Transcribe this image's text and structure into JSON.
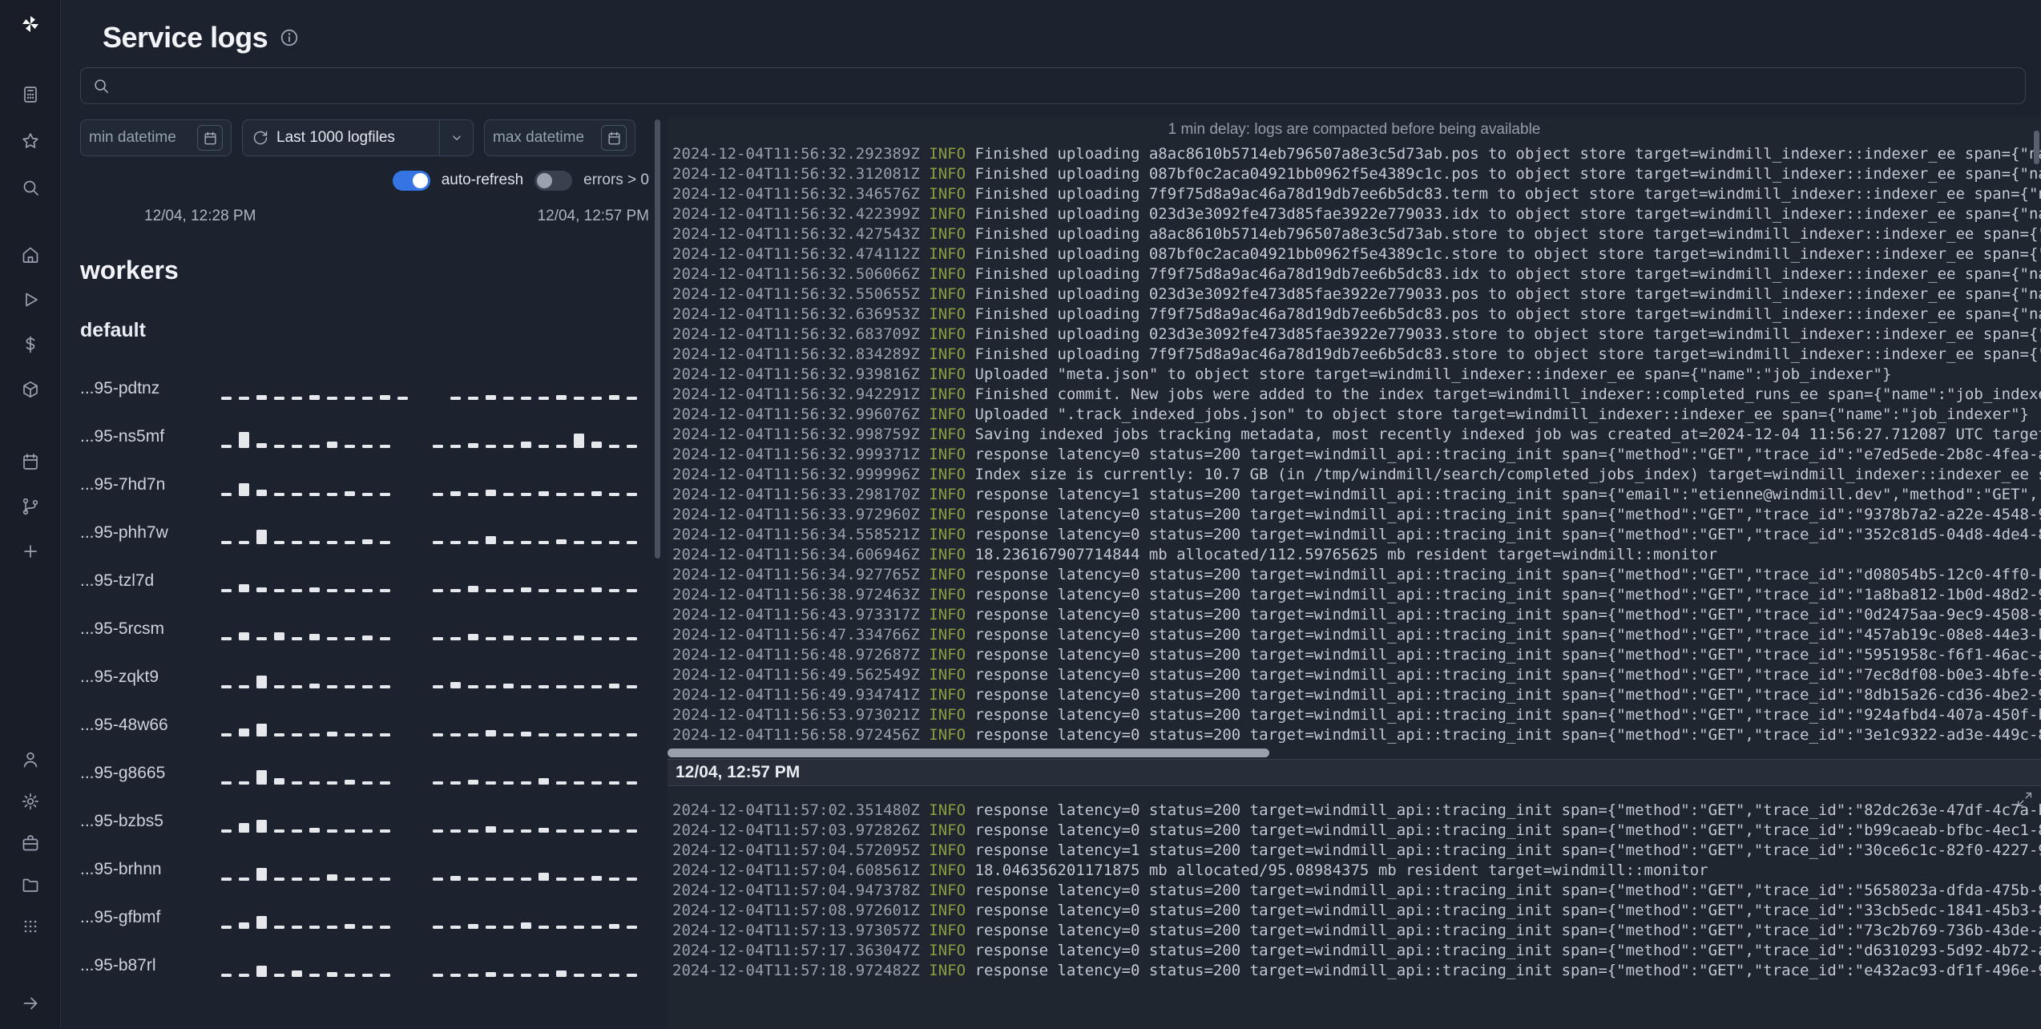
{
  "colors": {
    "accent_blue": "#3575e3",
    "log_info_green": "#8c9c41",
    "spark_bar": "#e6e8ec"
  },
  "header": {
    "title": "Service logs"
  },
  "sidebar": {
    "icons": [
      "windmill-logo",
      "calculator",
      "star",
      "search",
      "home",
      "play",
      "dollar",
      "cube",
      "calendar",
      "git-branch",
      "plus",
      "user",
      "gear",
      "briefcase",
      "folder",
      "grid",
      "arrow-right"
    ]
  },
  "search": {
    "value": "",
    "placeholder": ""
  },
  "filters": {
    "min_datetime_label": "min datetime",
    "logfiles_selector_label": "Last 1000 logfiles",
    "max_datetime_label": "max datetime",
    "auto_refresh_label": "auto-refresh",
    "auto_refresh_on": true,
    "errors_label": "errors > 0",
    "errors_on": false,
    "range_start": "12/04, 12:28 PM",
    "range_end": "12/04, 12:57 PM"
  },
  "workers": {
    "heading": "workers",
    "group": "default",
    "rows": [
      {
        "name": "...95-pdtnz",
        "bars": [
          4,
          4,
          6,
          4,
          4,
          6,
          4,
          4,
          4,
          6,
          4,
          0,
          0,
          4,
          4,
          6,
          4,
          4,
          4,
          6,
          4,
          4,
          6,
          4
        ]
      },
      {
        "name": "...95-ns5mf",
        "bars": [
          4,
          20,
          6,
          4,
          4,
          4,
          8,
          4,
          4,
          4,
          0,
          0,
          4,
          4,
          6,
          4,
          4,
          8,
          4,
          4,
          18,
          8,
          4,
          4
        ]
      },
      {
        "name": "...95-7hd7n",
        "bars": [
          4,
          16,
          8,
          4,
          4,
          4,
          4,
          6,
          4,
          4,
          0,
          0,
          4,
          6,
          4,
          8,
          4,
          4,
          6,
          4,
          4,
          6,
          4,
          4
        ]
      },
      {
        "name": "...95-phh7w",
        "bars": [
          4,
          4,
          18,
          4,
          4,
          4,
          4,
          4,
          6,
          4,
          0,
          0,
          4,
          4,
          4,
          10,
          4,
          4,
          4,
          6,
          4,
          4,
          4,
          4
        ]
      },
      {
        "name": "...95-tzl7d",
        "bars": [
          4,
          10,
          6,
          4,
          4,
          6,
          4,
          4,
          4,
          4,
          0,
          0,
          4,
          4,
          8,
          4,
          4,
          6,
          4,
          4,
          4,
          6,
          4,
          4
        ]
      },
      {
        "name": "...95-5rcsm",
        "bars": [
          4,
          10,
          4,
          10,
          4,
          8,
          4,
          4,
          6,
          4,
          0,
          0,
          4,
          4,
          8,
          4,
          6,
          4,
          4,
          4,
          6,
          4,
          4,
          4
        ]
      },
      {
        "name": "...95-zqkt9",
        "bars": [
          4,
          4,
          16,
          4,
          4,
          6,
          4,
          4,
          4,
          4,
          0,
          0,
          4,
          8,
          4,
          4,
          6,
          4,
          4,
          4,
          4,
          4,
          6,
          4
        ]
      },
      {
        "name": "...95-48w66",
        "bars": [
          4,
          10,
          16,
          4,
          4,
          4,
          6,
          4,
          4,
          4,
          0,
          0,
          4,
          4,
          4,
          8,
          4,
          6,
          4,
          4,
          4,
          4,
          4,
          4
        ]
      },
      {
        "name": "...95-g8665",
        "bars": [
          4,
          4,
          18,
          8,
          4,
          4,
          4,
          6,
          4,
          4,
          0,
          0,
          4,
          4,
          6,
          4,
          4,
          4,
          8,
          4,
          4,
          4,
          4,
          4
        ]
      },
      {
        "name": "...95-bzbs5",
        "bars": [
          4,
          12,
          16,
          4,
          4,
          6,
          4,
          4,
          4,
          4,
          0,
          0,
          4,
          4,
          4,
          8,
          4,
          4,
          6,
          4,
          4,
          4,
          4,
          4
        ]
      },
      {
        "name": "...95-brhnn",
        "bars": [
          4,
          4,
          16,
          4,
          4,
          4,
          8,
          4,
          4,
          4,
          0,
          0,
          4,
          6,
          4,
          4,
          4,
          4,
          10,
          4,
          4,
          6,
          4,
          4
        ]
      },
      {
        "name": "...95-gfbmf",
        "bars": [
          4,
          8,
          16,
          4,
          4,
          4,
          4,
          6,
          4,
          4,
          0,
          0,
          4,
          4,
          6,
          4,
          4,
          8,
          4,
          4,
          4,
          4,
          6,
          4
        ]
      },
      {
        "name": "...95-b87rl",
        "bars": [
          4,
          4,
          14,
          4,
          8,
          4,
          6,
          4,
          4,
          4,
          0,
          0,
          4,
          4,
          4,
          6,
          4,
          4,
          4,
          8,
          4,
          4,
          4,
          4
        ]
      }
    ]
  },
  "logs": {
    "notice": "1 min delay: logs are compacted before being available",
    "level_label": "INFO",
    "sections": [
      {
        "header": null,
        "lines": [
          {
            "ts": "2024-12-04T11:56:32.292389Z",
            "msg": "Finished uploading a8ac8610b5714eb796507a8e3c5d73ab.pos to object store target=windmill_indexer::indexer_ee span={\"na"
          },
          {
            "ts": "2024-12-04T11:56:32.312081Z",
            "msg": "Finished uploading 087bf0c2aca04921bb0962f5e4389c1c.pos to object store target=windmill_indexer::indexer_ee span={\"na"
          },
          {
            "ts": "2024-12-04T11:56:32.346576Z",
            "msg": "Finished uploading 7f9f75d8a9ac46a78d19db7ee6b5dc83.term to object store target=windmill_indexer::indexer_ee span={\"n"
          },
          {
            "ts": "2024-12-04T11:56:32.422399Z",
            "msg": "Finished uploading 023d3e3092fe473d85fae3922e779033.idx to object store target=windmill_indexer::indexer_ee span={\"na"
          },
          {
            "ts": "2024-12-04T11:56:32.427543Z",
            "msg": "Finished uploading a8ac8610b5714eb796507a8e3c5d73ab.store to object store target=windmill_indexer::indexer_ee span={\""
          },
          {
            "ts": "2024-12-04T11:56:32.474112Z",
            "msg": "Finished uploading 087bf0c2aca04921bb0962f5e4389c1c.store to object store target=windmill_indexer::indexer_ee span={\""
          },
          {
            "ts": "2024-12-04T11:56:32.506066Z",
            "msg": "Finished uploading 7f9f75d8a9ac46a78d19db7ee6b5dc83.idx to object store target=windmill_indexer::indexer_ee span={\"na"
          },
          {
            "ts": "2024-12-04T11:56:32.550655Z",
            "msg": "Finished uploading 023d3e3092fe473d85fae3922e779033.pos to object store target=windmill_indexer::indexer_ee span={\"na"
          },
          {
            "ts": "2024-12-04T11:56:32.636953Z",
            "msg": "Finished uploading 7f9f75d8a9ac46a78d19db7ee6b5dc83.pos to object store target=windmill_indexer::indexer_ee span={\"na"
          },
          {
            "ts": "2024-12-04T11:56:32.683709Z",
            "msg": "Finished uploading 023d3e3092fe473d85fae3922e779033.store to object store target=windmill_indexer::indexer_ee span={\""
          },
          {
            "ts": "2024-12-04T11:56:32.834289Z",
            "msg": "Finished uploading 7f9f75d8a9ac46a78d19db7ee6b5dc83.store to object store target=windmill_indexer::indexer_ee span={\""
          },
          {
            "ts": "2024-12-04T11:56:32.939816Z",
            "msg": "Uploaded \"meta.json\" to object store target=windmill_indexer::indexer_ee span={\"name\":\"job_indexer\"}"
          },
          {
            "ts": "2024-12-04T11:56:32.942291Z",
            "msg": "Finished commit. New jobs were added to the index target=windmill_indexer::completed_runs_ee span={\"name\":\"job_indexe"
          },
          {
            "ts": "2024-12-04T11:56:32.996076Z",
            "msg": "Uploaded \".track_indexed_jobs.json\" to object store target=windmill_indexer::indexer_ee span={\"name\":\"job_indexer\"}"
          },
          {
            "ts": "2024-12-04T11:56:32.998759Z",
            "msg": "Saving indexed jobs tracking metadata, most recently indexed job was created_at=2024-12-04 11:56:27.712087 UTC target"
          },
          {
            "ts": "2024-12-04T11:56:32.999371Z",
            "msg": "response latency=0 status=200 target=windmill_api::tracing_init span={\"method\":\"GET\",\"trace_id\":\"e7ed5ede-2b8c-4fea-a"
          },
          {
            "ts": "2024-12-04T11:56:32.999996Z",
            "msg": "Index size is currently: 10.7 GB (in /tmp/windmill/search/completed_jobs_index) target=windmill_indexer::indexer_ee s"
          },
          {
            "ts": "2024-12-04T11:56:33.298170Z",
            "msg": "response latency=1 status=200 target=windmill_api::tracing_init span={\"email\":\"etienne@windmill.dev\",\"method\":\"GET\","
          },
          {
            "ts": "2024-12-04T11:56:33.972960Z",
            "msg": "response latency=0 status=200 target=windmill_api::tracing_init span={\"method\":\"GET\",\"trace_id\":\"9378b7a2-a22e-4548-9"
          },
          {
            "ts": "2024-12-04T11:56:34.558521Z",
            "msg": "response latency=0 status=200 target=windmill_api::tracing_init span={\"method\":\"GET\",\"trace_id\":\"352c81d5-04d8-4de4-8"
          },
          {
            "ts": "2024-12-04T11:56:34.606946Z",
            "msg": "18.236167907714844 mb allocated/112.59765625 mb resident target=windmill::monitor"
          },
          {
            "ts": "2024-12-04T11:56:34.927765Z",
            "msg": "response latency=0 status=200 target=windmill_api::tracing_init span={\"method\":\"GET\",\"trace_id\":\"d08054b5-12c0-4ff0-b"
          },
          {
            "ts": "2024-12-04T11:56:38.972463Z",
            "msg": "response latency=0 status=200 target=windmill_api::tracing_init span={\"method\":\"GET\",\"trace_id\":\"1a8ba812-1b0d-48d2-9"
          },
          {
            "ts": "2024-12-04T11:56:43.973317Z",
            "msg": "response latency=0 status=200 target=windmill_api::tracing_init span={\"method\":\"GET\",\"trace_id\":\"0d2475aa-9ec9-4508-9"
          },
          {
            "ts": "2024-12-04T11:56:47.334766Z",
            "msg": "response latency=0 status=200 target=windmill_api::tracing_init span={\"method\":\"GET\",\"trace_id\":\"457ab19c-08e8-44e3-b"
          },
          {
            "ts": "2024-12-04T11:56:48.972687Z",
            "msg": "response latency=0 status=200 target=windmill_api::tracing_init span={\"method\":\"GET\",\"trace_id\":\"5951958c-f6f1-46ac-a"
          },
          {
            "ts": "2024-12-04T11:56:49.562549Z",
            "msg": "response latency=0 status=200 target=windmill_api::tracing_init span={\"method\":\"GET\",\"trace_id\":\"7ec8df08-b0e3-4bfe-9"
          },
          {
            "ts": "2024-12-04T11:56:49.934741Z",
            "msg": "response latency=0 status=200 target=windmill_api::tracing_init span={\"method\":\"GET\",\"trace_id\":\"8db15a26-cd36-4be2-9"
          },
          {
            "ts": "2024-12-04T11:56:53.973021Z",
            "msg": "response latency=0 status=200 target=windmill_api::tracing_init span={\"method\":\"GET\",\"trace_id\":\"924afbd4-407a-450f-b"
          },
          {
            "ts": "2024-12-04T11:56:58.972456Z",
            "msg": "response latency=0 status=200 target=windmill_api::tracing_init span={\"method\":\"GET\",\"trace_id\":\"3e1c9322-ad3e-449c-8"
          }
        ]
      },
      {
        "header": "12/04, 12:57 PM",
        "lines": [
          {
            "ts": "2024-12-04T11:57:02.351480Z",
            "msg": "response latency=0 status=200 target=windmill_api::tracing_init span={\"method\":\"GET\",\"trace_id\":\"82dc263e-47df-4c7a-b"
          },
          {
            "ts": "2024-12-04T11:57:03.972826Z",
            "msg": "response latency=0 status=200 target=windmill_api::tracing_init span={\"method\":\"GET\",\"trace_id\":\"b99caeab-bfbc-4ec1-8"
          },
          {
            "ts": "2024-12-04T11:57:04.572095Z",
            "msg": "response latency=1 status=200 target=windmill_api::tracing_init span={\"method\":\"GET\",\"trace_id\":\"30ce6c1c-82f0-4227-9"
          },
          {
            "ts": "2024-12-04T11:57:04.608561Z",
            "msg": "18.046356201171875 mb allocated/95.08984375 mb resident target=windmill::monitor"
          },
          {
            "ts": "2024-12-04T11:57:04.947378Z",
            "msg": "response latency=0 status=200 target=windmill_api::tracing_init span={\"method\":\"GET\",\"trace_id\":\"5658023a-dfda-475b-9"
          },
          {
            "ts": "2024-12-04T11:57:08.972601Z",
            "msg": "response latency=0 status=200 target=windmill_api::tracing_init span={\"method\":\"GET\",\"trace_id\":\"33cb5edc-1841-45b3-8"
          },
          {
            "ts": "2024-12-04T11:57:13.973057Z",
            "msg": "response latency=0 status=200 target=windmill_api::tracing_init span={\"method\":\"GET\",\"trace_id\":\"73c2b769-736b-43de-a"
          },
          {
            "ts": "2024-12-04T11:57:17.363047Z",
            "msg": "response latency=0 status=200 target=windmill_api::tracing_init span={\"method\":\"GET\",\"trace_id\":\"d6310293-5d92-4b72-a"
          },
          {
            "ts": "2024-12-04T11:57:18.972482Z",
            "msg": "response latency=0 status=200 target=windmill_api::tracing_init span={\"method\":\"GET\",\"trace_id\":\"e432ac93-df1f-496e-9"
          }
        ]
      }
    ]
  }
}
